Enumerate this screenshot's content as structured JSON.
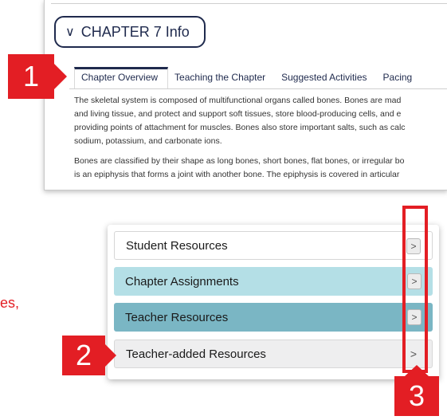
{
  "chapter": {
    "toggle_label": "CHAPTER 7 Info",
    "tabs": [
      {
        "label": "Chapter Overview",
        "active": true
      },
      {
        "label": "Teaching the Chapter"
      },
      {
        "label": "Suggested Activities"
      },
      {
        "label": "Pacing"
      }
    ],
    "overview": {
      "paragraph1_lines": [
        "The skeletal system is composed of multifunctional organs called bones. Bones are mad",
        "and living tissue, and protect and support soft tissues, store blood-producing cells, and e",
        "providing points of attachment for muscles. Bones also store important salts, such as calc",
        "sodium, potassium, and carbonate ions."
      ],
      "paragraph2_lines": [
        "Bones are classified by their shape as long bones, short bones, flat bones, or irregular bo",
        "is an epiphysis that forms a joint with another bone. The epiphysis is covered in articular"
      ]
    }
  },
  "resources": {
    "items": [
      {
        "label": "Student Resources",
        "arrow": ">"
      },
      {
        "label": "Chapter Assignments",
        "arrow": ">"
      },
      {
        "label": "Teacher Resources",
        "arrow": ">"
      },
      {
        "label": "Teacher-added Resources",
        "arrow": ">"
      }
    ]
  },
  "callouts": {
    "one": "1",
    "two": "2",
    "three": "3",
    "side_text_fragment": "es,"
  },
  "colors": {
    "callout_red": "#e31e24",
    "navy": "#1f2a4d",
    "row_light_teal": "#b4dfe6",
    "row_dark_teal": "#7ab6c4",
    "row_gray": "#eeeeef"
  },
  "icons": {
    "chevron": "chevron-down-icon",
    "row_arrow": "chevron-right-icon"
  }
}
